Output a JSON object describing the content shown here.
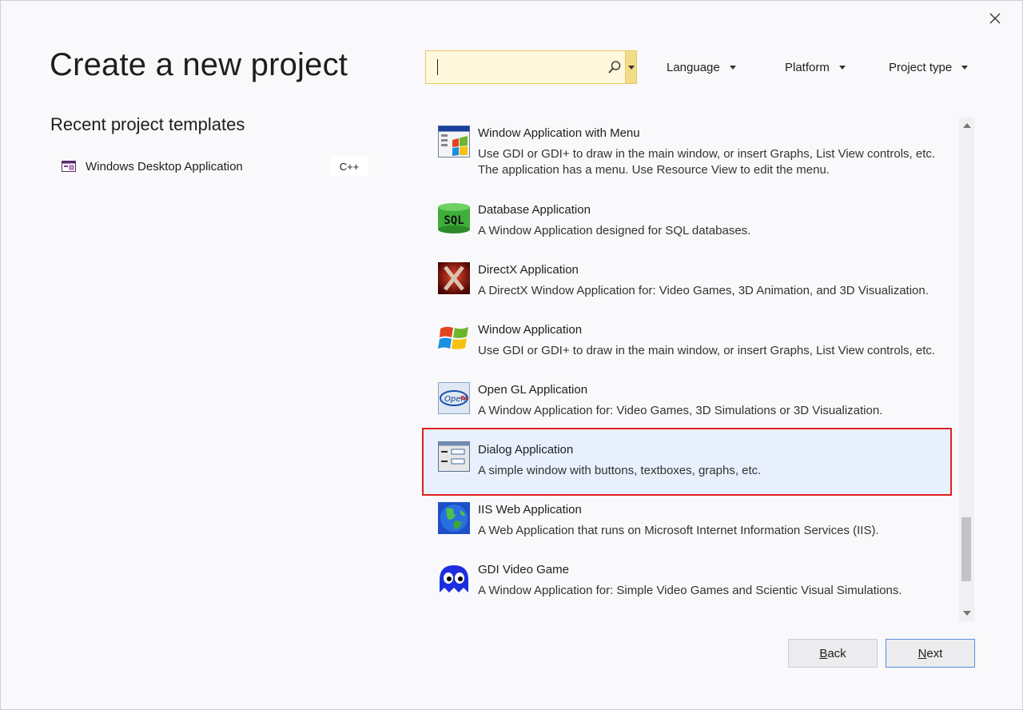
{
  "dialog": {
    "title": "Create a new project"
  },
  "recent": {
    "title": "Recent project templates",
    "items": [
      {
        "label": "Windows Desktop Application",
        "language": "C++",
        "icon": "windows-desktop-icon"
      }
    ]
  },
  "search": {
    "placeholder": "",
    "value": ""
  },
  "filters": {
    "language": "Language",
    "platform": "Platform",
    "project_type": "Project type"
  },
  "templates": [
    {
      "name": "Window Application with Menu",
      "description": "Use GDI or GDI+ to draw in the main window, or insert Graphs, List View controls, etc.\nThe application has a menu.  Use Resource View to edit the menu.",
      "icon": "window-menu-icon"
    },
    {
      "name": "Database Application",
      "description": "A Window Application designed for SQL databases.",
      "icon": "sql-database-icon"
    },
    {
      "name": "DirectX Application",
      "description": "A DirectX Window Application for: Video Games, 3D Animation, and 3D Visualization.",
      "icon": "directx-icon"
    },
    {
      "name": "Window Application",
      "description": "Use GDI or GDI+ to draw in the main window, or insert Graphs, List View controls, etc.",
      "icon": "windows-flag-icon"
    },
    {
      "name": "Open GL Application",
      "description": "A Window Application for: Video Games, 3D Simulations or 3D Visualization.",
      "icon": "opengl-icon"
    },
    {
      "name": "Dialog Application",
      "description": "A simple window with buttons, textboxes, graphs, etc.",
      "icon": "dialog-window-icon"
    },
    {
      "name": "IIS Web Application",
      "description": "A Web Application that runs on Microsoft Internet Information Services (IIS).",
      "icon": "globe-icon"
    },
    {
      "name": "GDI Video Game",
      "description": "A Window Application for: Simple Video Games and Scientic Visual Simulations.",
      "icon": "ghost-icon"
    }
  ],
  "selected_template": "Dialog Application",
  "buttons": {
    "back": {
      "accel": "B",
      "rest": "ack"
    },
    "next": {
      "accel": "N",
      "rest": "ext"
    }
  },
  "colors": {
    "selection_border": "#e02020",
    "selection_fill": "#e9f0fd",
    "search_border": "#e8c766"
  }
}
